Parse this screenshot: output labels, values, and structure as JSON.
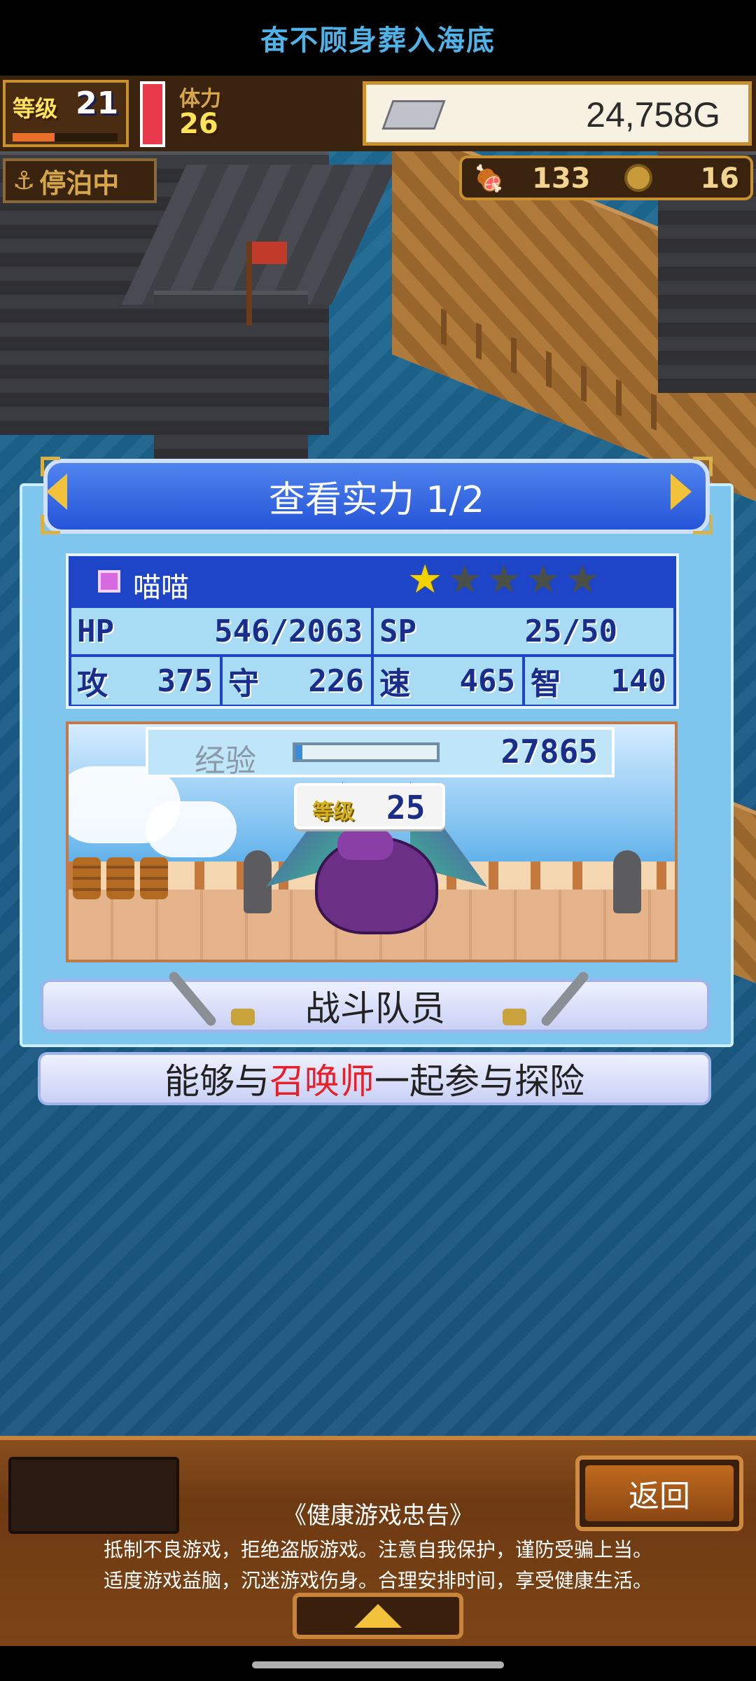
{
  "app_title": "奋不顾身葬入海底",
  "status": {
    "level_label": "等级",
    "level_value": "21",
    "stamina_label": "体力",
    "stamina_value": "26",
    "gold": "24,758G",
    "anchor_status": "停泊中",
    "food_count": "133",
    "medal_count": "16"
  },
  "card": {
    "header_title": "查看实力 1/2",
    "name": "喵喵",
    "stars_filled": 1,
    "stars_total": 5,
    "hp_label": "HP",
    "hp_value": "546/2063",
    "sp_label": "SP",
    "sp_value": "25/50",
    "atk_label": "攻",
    "atk_value": "375",
    "def_label": "守",
    "def_value": "226",
    "spd_label": "速",
    "spd_value": "465",
    "int_label": "智",
    "int_value": "140",
    "exp_label": "经验",
    "exp_value": "27865",
    "exp_fill": 0.05,
    "monster_level_label": "等级",
    "monster_level_value": "25",
    "role": "战斗队员",
    "desc_before": "能够与",
    "desc_highlight": "召唤师",
    "desc_after": "一起参与探险"
  },
  "footer": {
    "back_label": "返回",
    "notice_title": "《健康游戏忠告》",
    "notice_line1": "抵制不良游戏，拒绝盗版游戏。注意自我保护，谨防受骗上当。",
    "notice_line2": "适度游戏益脑，沉迷游戏伤身。合理安排时间，享受健康生活。"
  },
  "colors": {
    "title_blue": "#4fb3e8",
    "highlight_red": "#e8202a",
    "panel_blue": "#7ec6ee",
    "header_blue": "#2f61df"
  }
}
